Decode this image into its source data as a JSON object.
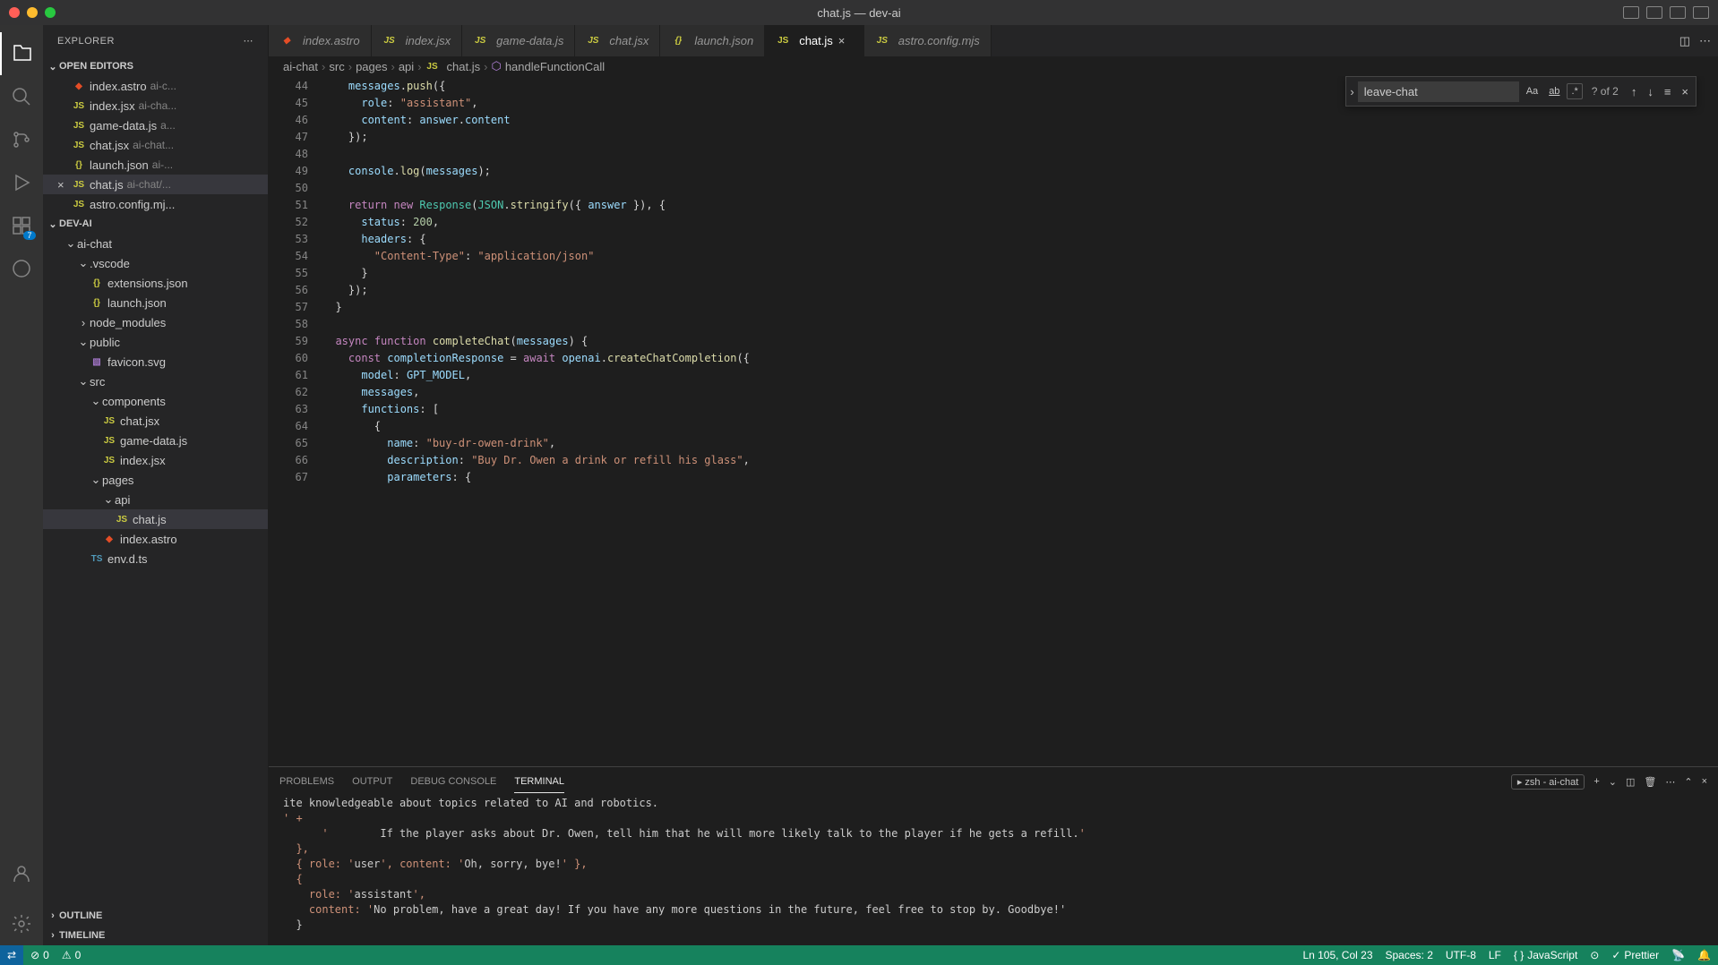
{
  "titlebar": {
    "title": "chat.js — dev-ai"
  },
  "sidebar": {
    "title": "EXPLORER",
    "openEditors": {
      "label": "OPEN EDITORS",
      "items": [
        {
          "name": "index.astro",
          "hint": "ai-c..."
        },
        {
          "name": "index.jsx",
          "hint": "ai-cha..."
        },
        {
          "name": "game-data.js",
          "hint": "a..."
        },
        {
          "name": "chat.jsx",
          "hint": "ai-chat..."
        },
        {
          "name": "launch.json",
          "hint": "ai-..."
        },
        {
          "name": "chat.js",
          "hint": "ai-chat/..."
        },
        {
          "name": "astro.config.mj...",
          "hint": ""
        }
      ]
    },
    "workspace": {
      "label": "DEV-AI",
      "tree": [
        {
          "name": "ai-chat",
          "type": "folder",
          "depth": 1,
          "open": true
        },
        {
          "name": ".vscode",
          "type": "folder",
          "depth": 2,
          "open": true
        },
        {
          "name": "extensions.json",
          "type": "json",
          "depth": 3
        },
        {
          "name": "launch.json",
          "type": "json",
          "depth": 3
        },
        {
          "name": "node_modules",
          "type": "folder",
          "depth": 2,
          "open": false
        },
        {
          "name": "public",
          "type": "folder",
          "depth": 2,
          "open": true
        },
        {
          "name": "favicon.svg",
          "type": "svg",
          "depth": 3
        },
        {
          "name": "src",
          "type": "folder",
          "depth": 2,
          "open": true
        },
        {
          "name": "components",
          "type": "folder",
          "depth": 3,
          "open": true
        },
        {
          "name": "chat.jsx",
          "type": "js",
          "depth": 4
        },
        {
          "name": "game-data.js",
          "type": "js",
          "depth": 4
        },
        {
          "name": "index.jsx",
          "type": "js",
          "depth": 4
        },
        {
          "name": "pages",
          "type": "folder",
          "depth": 3,
          "open": true
        },
        {
          "name": "api",
          "type": "folder",
          "depth": 4,
          "open": true
        },
        {
          "name": "chat.js",
          "type": "js",
          "depth": 5,
          "selected": true
        },
        {
          "name": "index.astro",
          "type": "astro",
          "depth": 4
        },
        {
          "name": "env.d.ts",
          "type": "ts",
          "depth": 3
        }
      ]
    },
    "outline": "OUTLINE",
    "timeline": "TIMELINE"
  },
  "activitybar": {
    "badge": "7"
  },
  "tabs": [
    {
      "label": "index.astro",
      "icon": "astro"
    },
    {
      "label": "index.jsx",
      "icon": "js"
    },
    {
      "label": "game-data.js",
      "icon": "js"
    },
    {
      "label": "chat.jsx",
      "icon": "js"
    },
    {
      "label": "launch.json",
      "icon": "json"
    },
    {
      "label": "chat.js",
      "icon": "js",
      "active": true
    },
    {
      "label": "astro.config.mjs",
      "icon": "js"
    }
  ],
  "breadcrumb": {
    "parts": [
      "ai-chat",
      "src",
      "pages",
      "api",
      "chat.js",
      "handleFunctionCall"
    ]
  },
  "find": {
    "value": "leave-chat",
    "result": "? of 2",
    "aa": "Aa",
    "ab": "ab",
    "re": ".*"
  },
  "code": {
    "startLine": 44,
    "lines": [
      "    messages.push({",
      "      role: \"assistant\",",
      "      content: answer.content",
      "    });",
      "",
      "    console.log(messages);",
      "",
      "    return new Response(JSON.stringify({ answer }), {",
      "      status: 200,",
      "      headers: {",
      "        \"Content-Type\": \"application/json\"",
      "      }",
      "    });",
      "  }",
      "",
      "  async function completeChat(messages) {",
      "    const completionResponse = await openai.createChatCompletion({",
      "      model: GPT_MODEL,",
      "      messages,",
      "      functions: [",
      "        {",
      "          name: \"buy-dr-owen-drink\",",
      "          description: \"Buy Dr. Owen a drink or refill his glass\",",
      "          parameters: {"
    ]
  },
  "panel": {
    "tabs": {
      "problems": "PROBLEMS",
      "output": "OUTPUT",
      "debug": "DEBUG CONSOLE",
      "terminal": "TERMINAL"
    },
    "shell": "zsh - ai-chat",
    "content": "ite knowledgeable about topics related to AI and robotics.\\n' +\n      '        If the player asks about Dr. Owen, tell him that he will more likely talk to the player if he gets a refill.'\n  },\n  { role: 'user', content: 'Oh, sorry, bye!' },\n  {\n    role: 'assistant',\n    content: 'No problem, have a great day! If you have any more questions in the future, feel free to stop by. Goodbye!'\n  }"
  },
  "statusbar": {
    "errors": "0",
    "warnings": "0",
    "cursor": "Ln 105, Col 23",
    "spaces": "Spaces: 2",
    "encoding": "UTF-8",
    "eol": "LF",
    "lang": "JavaScript",
    "prettier": "Prettier"
  }
}
